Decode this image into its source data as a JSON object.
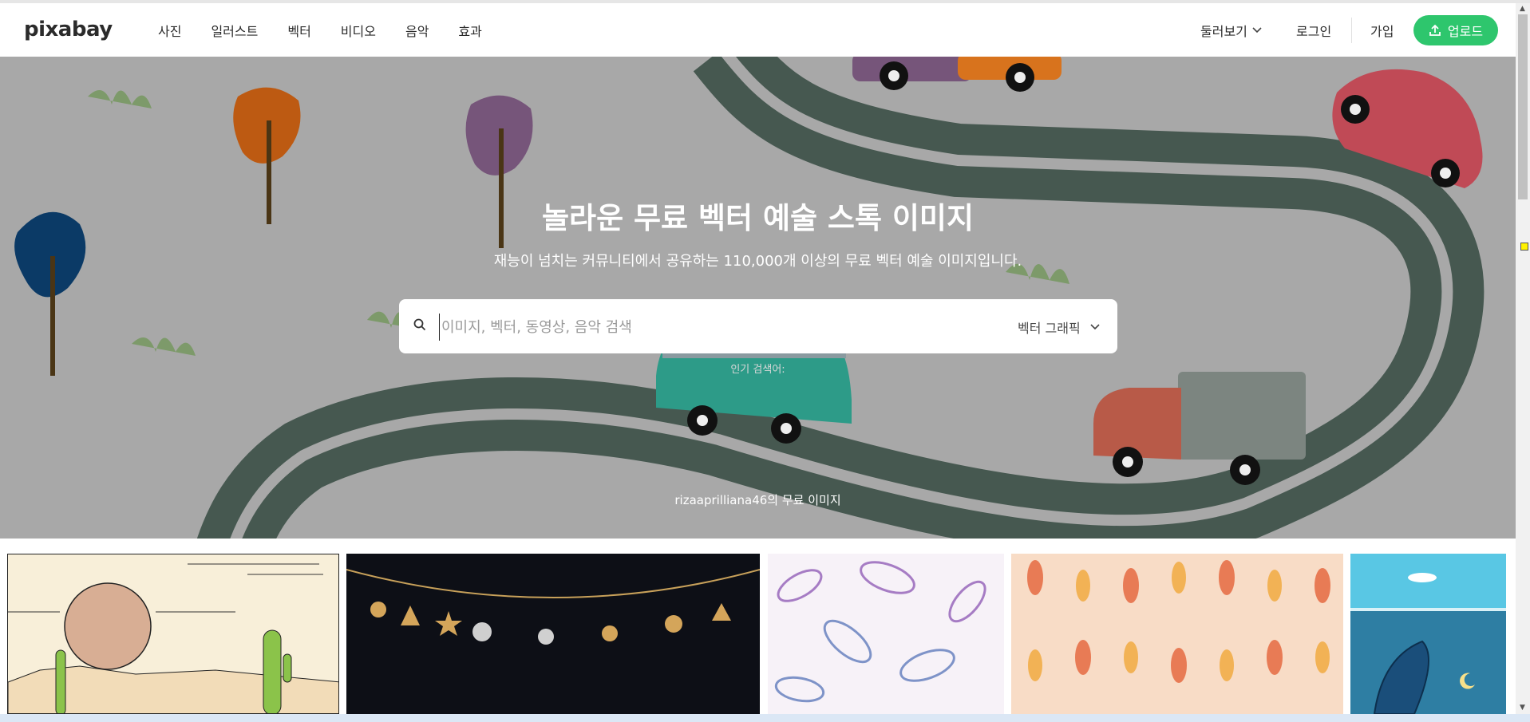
{
  "header": {
    "logo": "pixabay",
    "nav": [
      "사진",
      "일러스트",
      "벡터",
      "비디오",
      "음악",
      "효과"
    ],
    "explore_label": "둘러보기",
    "login_label": "로그인",
    "join_label": "가입",
    "upload_label": "업로드"
  },
  "hero": {
    "title": "놀라운 무료 벡터 예술 스톡 이미지",
    "subtitle": "재능이 넘치는 커뮤니티에서 공유하는 110,000개 이상의 무료 벡터 예술 이미지입니다.",
    "search_placeholder": "이미지, 벡터, 동영상, 음악 검색",
    "search_value": "",
    "filter_label": "벡터 그래픽",
    "popular_label": "인기 검색어:",
    "credit": "rizaaprilliana46의 무료 이미지"
  },
  "icons": {
    "search": "search-icon",
    "chevron": "chevron-down-icon",
    "upload": "upload-icon"
  },
  "colors": {
    "accent": "#2ec66d",
    "hero_bg": "#a8a8a8",
    "road": "#465850"
  }
}
